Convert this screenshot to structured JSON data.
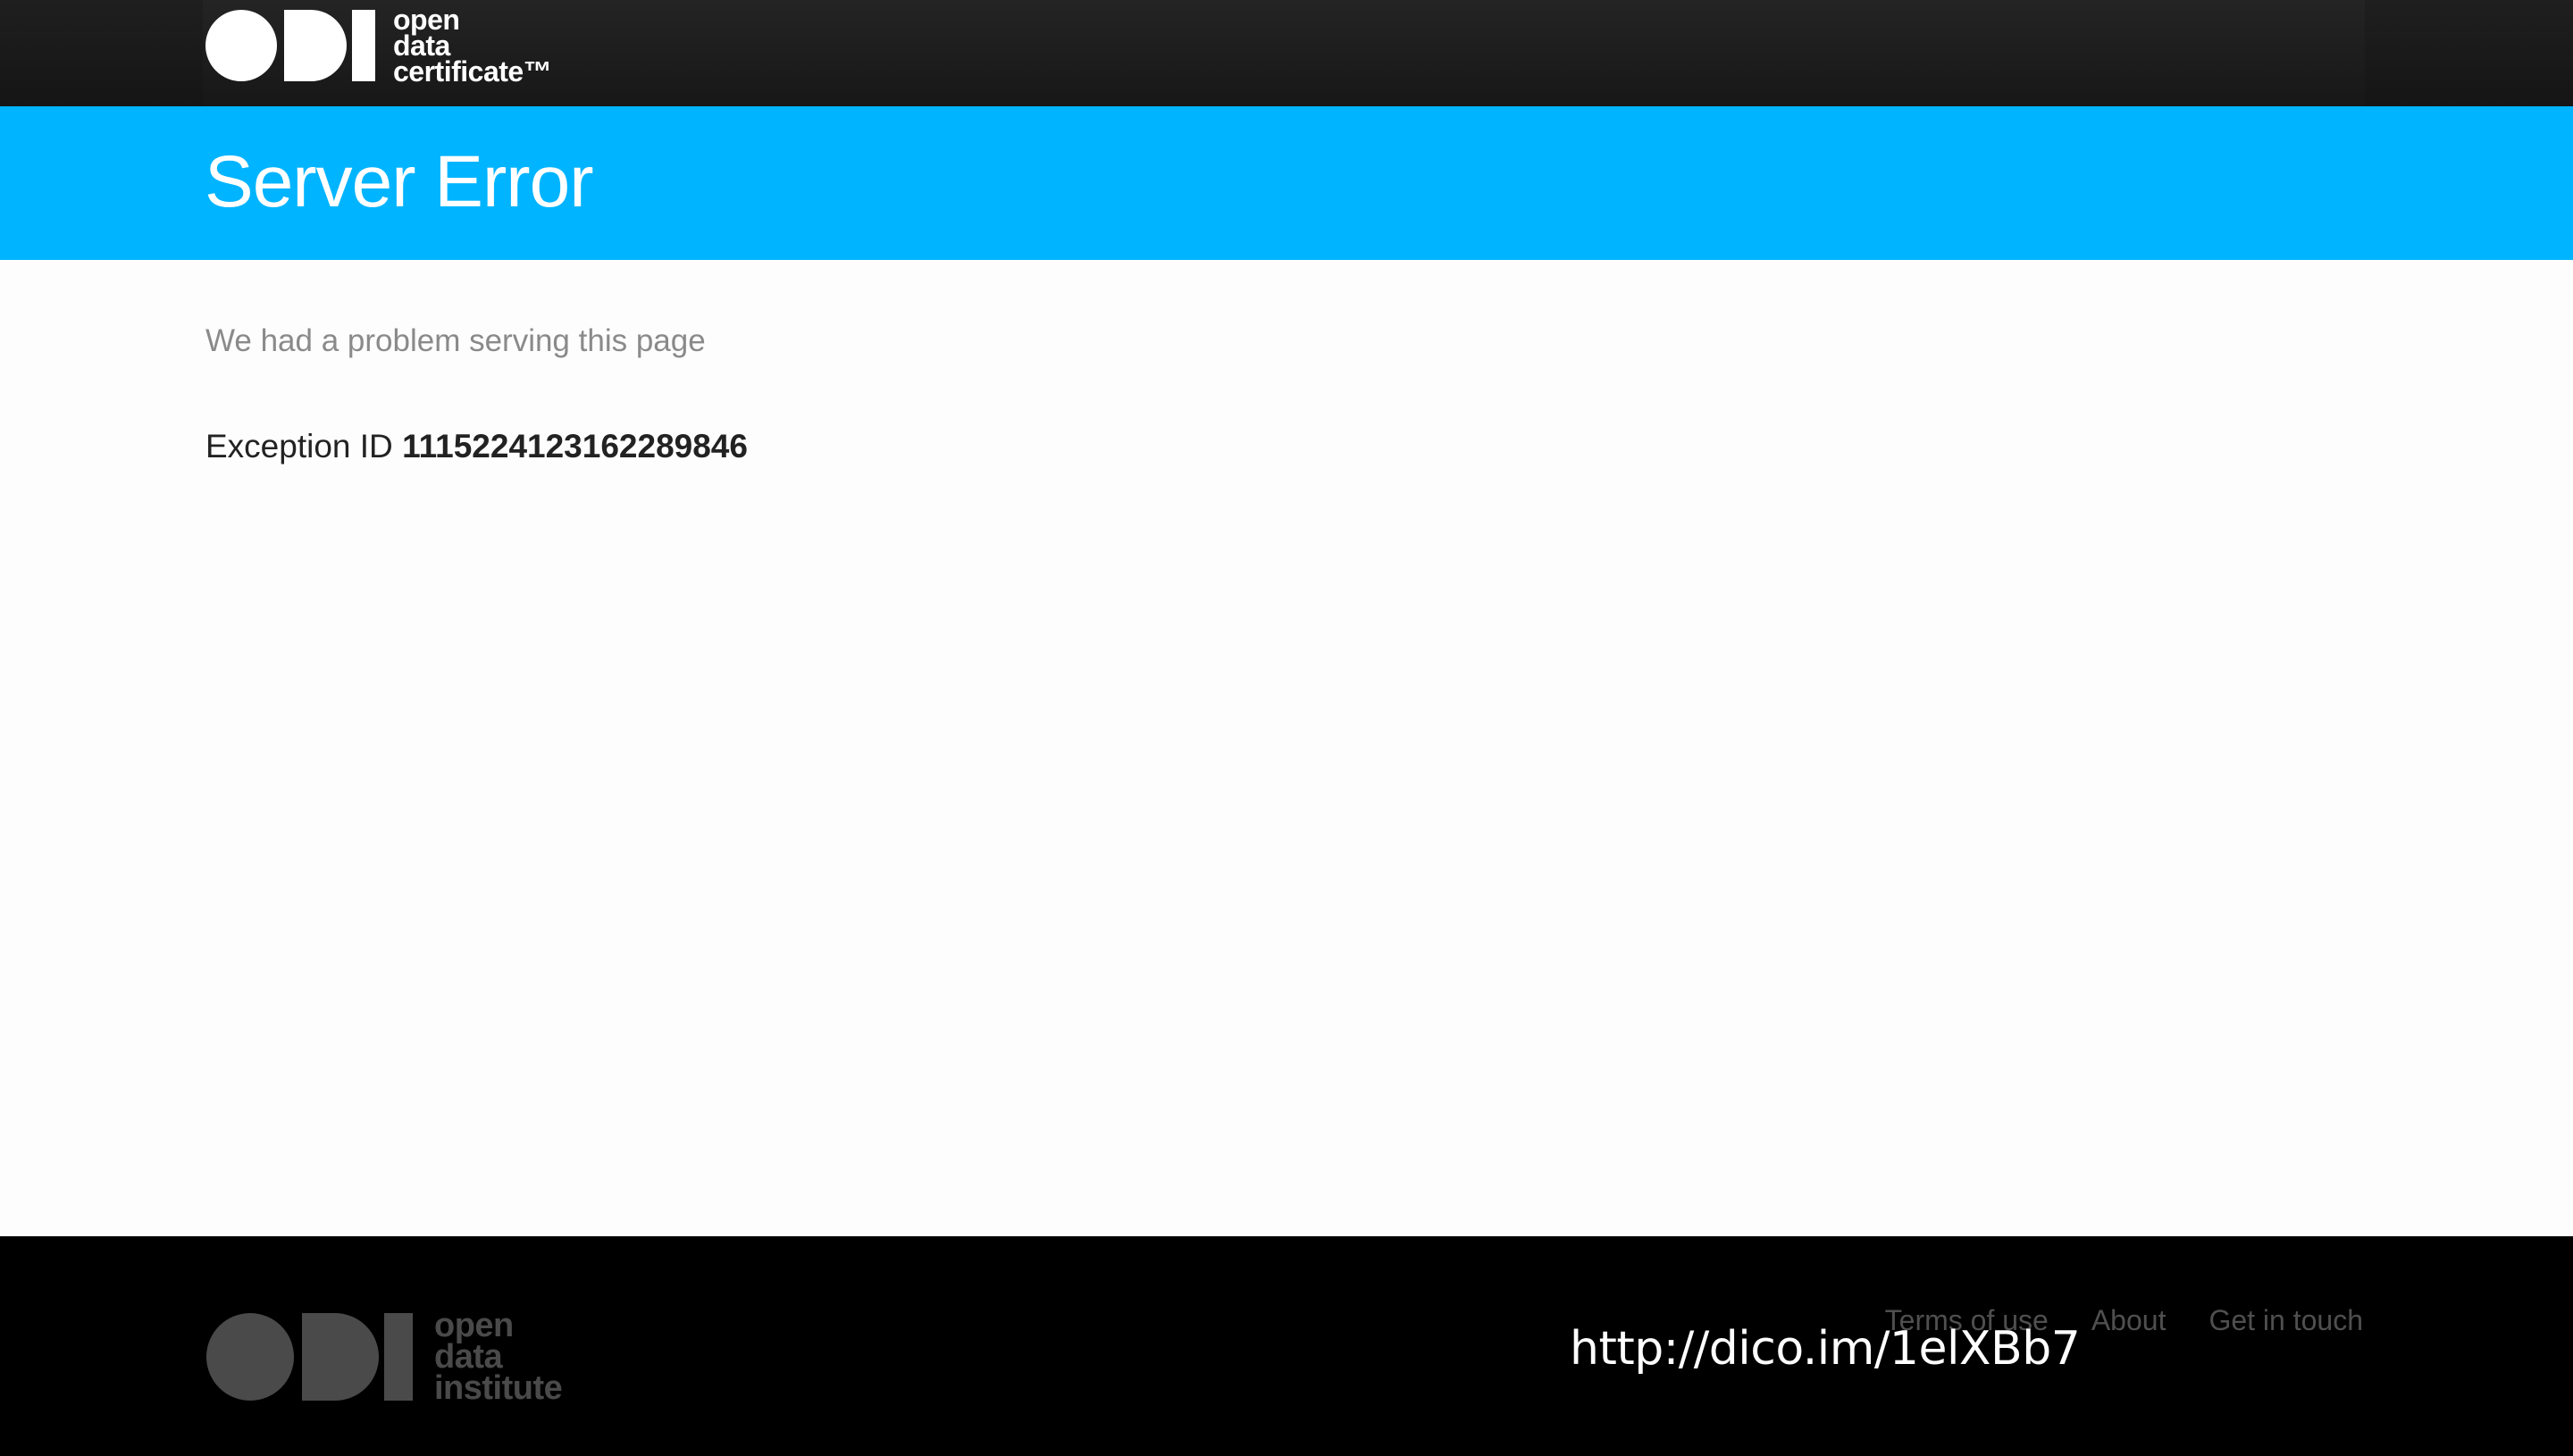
{
  "header": {
    "logo_lines": [
      "open",
      "data",
      "certificate™"
    ]
  },
  "banner": {
    "title": "Server Error"
  },
  "content": {
    "message": "We had a problem serving this page",
    "exception_label": "Exception ID ",
    "exception_id": "1115224123162289846"
  },
  "footer": {
    "logo_lines": [
      "open",
      "data",
      "institute"
    ],
    "links": [
      "Terms of use",
      "About",
      "Get in touch"
    ]
  },
  "overlay": {
    "url": "http://dico.im/1elXBb7"
  },
  "colors": {
    "banner": "#00b4ff",
    "header_bg": "#1b1b1b",
    "footer_bg": "#000000",
    "footer_logo": "#4a4a4a"
  },
  "icons": {
    "header_logo": "odi-logo-icon",
    "footer_logo": "odi-logo-icon"
  }
}
